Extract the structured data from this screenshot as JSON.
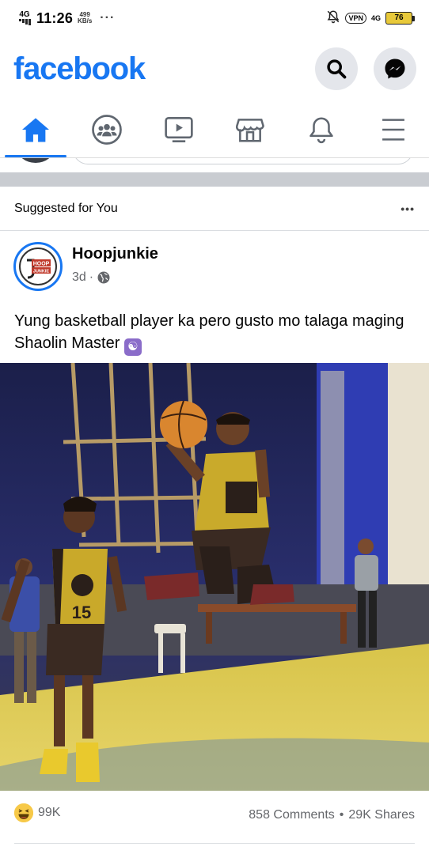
{
  "status_bar": {
    "network_left": "4G",
    "time": "11:26",
    "speed_value": "499",
    "speed_unit": "KB/s",
    "more": "···",
    "vpn": "VPN",
    "network_right": "4G",
    "battery": "76"
  },
  "header": {
    "logo": "facebook",
    "search_icon": "search-icon",
    "messenger_icon": "messenger-icon"
  },
  "nav": {
    "items": [
      {
        "icon": "home-icon",
        "active": true
      },
      {
        "icon": "groups-icon",
        "active": false
      },
      {
        "icon": "watch-icon",
        "active": false
      },
      {
        "icon": "marketplace-icon",
        "active": false
      },
      {
        "icon": "bell-icon",
        "active": false
      },
      {
        "icon": "menu-icon",
        "active": false
      }
    ],
    "accent_color": "#1877f2"
  },
  "feed": {
    "section_label": "Suggested for You",
    "section_more": "•••",
    "post": {
      "page_name": "Hoopjunkie",
      "avatar_text_top": "HOOP",
      "avatar_text_bottom": "JUNKIE",
      "time": "3d",
      "time_separator": "·",
      "audience_icon": "globe-icon",
      "caption": "Yung basketball player ka pero gusto mo talaga maging Shaolin Master",
      "caption_emoji": "☯",
      "jersey_number": "15",
      "reaction_icon": "haha-icon",
      "reactions": "99K",
      "comments": "858 Comments",
      "dot": "•",
      "shares": "29K Shares"
    }
  }
}
